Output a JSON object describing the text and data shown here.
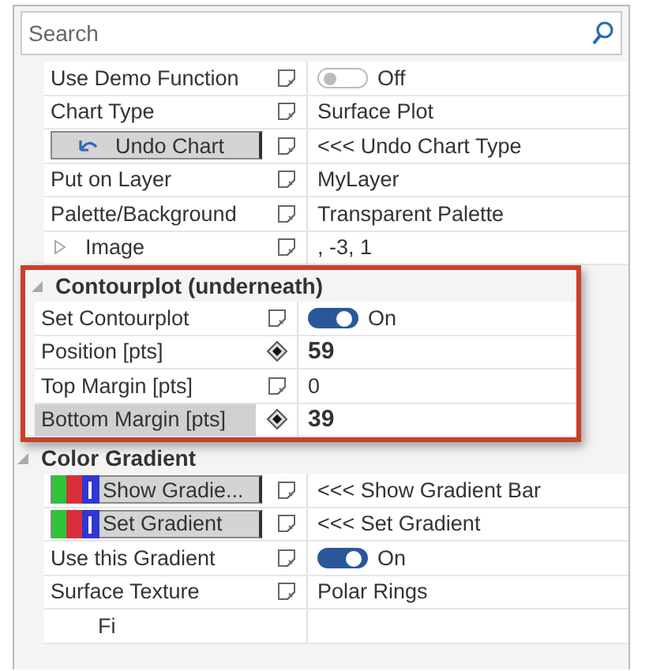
{
  "search": {
    "placeholder": "Search"
  },
  "groups": [
    {
      "highlighted": false,
      "rows": [
        {
          "label": "Use Demo Function",
          "kind": "text",
          "on": false,
          "value": "Off",
          "selected": false
        },
        {
          "label": "Chart Type",
          "kind": "text",
          "modified": false,
          "value": "Surface Plot",
          "selected": false
        },
        {
          "label": "Undo Chart",
          "kind": "undo_button",
          "modified": false,
          "value": "<<< Undo Chart Type",
          "selected": false
        },
        {
          "label": "Put on Layer",
          "kind": "text",
          "modified": false,
          "value": "MyLayer",
          "selected": false
        },
        {
          "label": "Palette/Background",
          "kind": "text",
          "modified": false,
          "value": "Transparent Palette",
          "selected": false
        },
        {
          "label": "Image",
          "kind": "expander",
          "expanded": false,
          "modified": false,
          "value": ", -3, 1",
          "selected": false
        }
      ]
    },
    {
      "title": "Contourplot (underneath)",
      "highlighted": true,
      "rows": [
        {
          "label": "Set Contourplot",
          "kind": "text",
          "on": true,
          "value": "On",
          "selected": false
        },
        {
          "label": "Position [pts]",
          "kind": "text",
          "modified": true,
          "value": "59",
          "selected": false
        },
        {
          "label": "Top Margin [pts]",
          "kind": "text",
          "modified": false,
          "value": "0",
          "selected": false
        },
        {
          "label": "Bottom Margin [pts]",
          "kind": "text",
          "modified": true,
          "value": "39",
          "selected": true
        }
      ]
    },
    {
      "title": "Color Gradient",
      "highlighted": false,
      "rows": [
        {
          "label": "Show Gradie...",
          "kind": "gradient_button",
          "modified": false,
          "value": "<<< Show Gradient Bar",
          "selected": false
        },
        {
          "label": "Set Gradient",
          "kind": "gradient_button",
          "modified": false,
          "value": "<<< Set Gradient",
          "selected": false
        },
        {
          "label": "Use this Gradient",
          "kind": "text",
          "on": true,
          "value": "On",
          "selected": false
        },
        {
          "label": "Surface Texture",
          "kind": "text",
          "modified": false,
          "value": "Polar Rings",
          "selected": false
        },
        {
          "label": "Fi",
          "kind": "nested",
          "selected": false
        }
      ]
    }
  ]
}
